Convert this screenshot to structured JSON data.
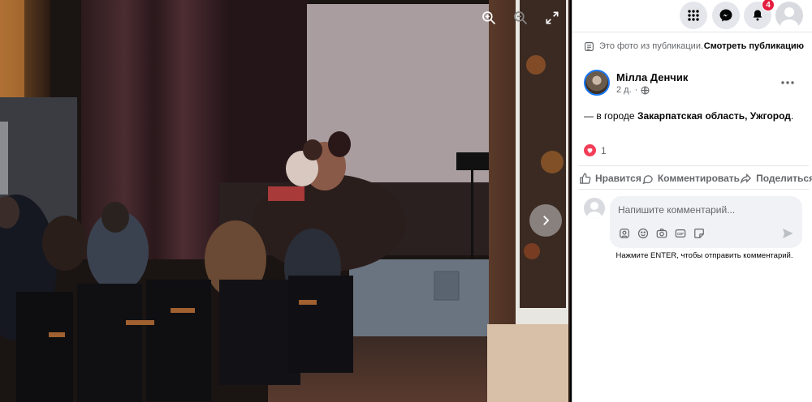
{
  "viewer": {
    "zoom_in_label": "zoom-in",
    "zoom_out_label": "zoom-out",
    "fullscreen_label": "fullscreen",
    "next_label": "next-photo"
  },
  "topbar": {
    "notifications_count": "4"
  },
  "post": {
    "note_text": "Это фото из публикации.",
    "view_post_link": "Смотреть публикацию",
    "author": "Мілла Денчик",
    "time": "2 д.",
    "text_prefix": "— в городе",
    "location": "Закарпатская область, Ужгород",
    "text_suffix": ".",
    "reaction_count": "1"
  },
  "actions": {
    "like": "Нравится",
    "comment": "Комментировать",
    "share": "Поделиться"
  },
  "comment": {
    "placeholder": "Напишите комментарий...",
    "hint": "Нажмите ENTER, чтобы отправить комментарий."
  },
  "colors": {
    "accent": "#1877f2",
    "badge": "#e41e3f",
    "heart": "#f33e58",
    "muted": "#65676b"
  }
}
